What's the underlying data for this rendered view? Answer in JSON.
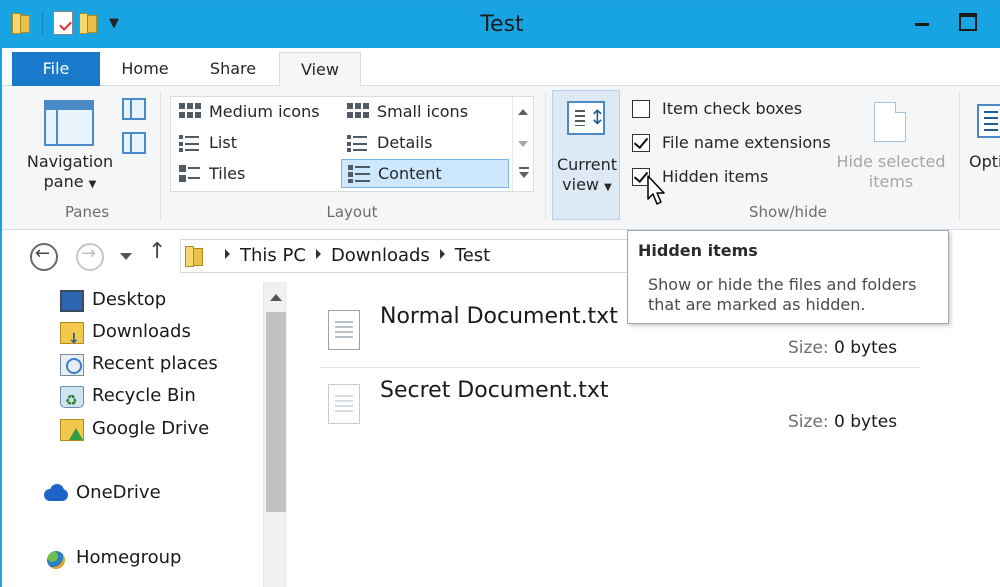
{
  "window": {
    "title": "Test"
  },
  "tabs": {
    "file": "File",
    "home": "Home",
    "share": "Share",
    "view": "View"
  },
  "ribbon": {
    "panes": {
      "navigation_pane_label": "Navigation pane",
      "group_label": "Panes"
    },
    "layout": {
      "group_label": "Layout",
      "items": [
        "Medium icons",
        "Small icons",
        "List",
        "Details",
        "Tiles",
        "Content"
      ],
      "selected": "Content"
    },
    "current_view": {
      "label": "Current view"
    },
    "show_hide": {
      "group_label": "Show/hide",
      "item_check_boxes": {
        "label": "Item check boxes",
        "checked": false
      },
      "file_name_extensions": {
        "label": "File name extensions",
        "checked": true
      },
      "hidden_items": {
        "label": "Hidden items",
        "checked": true
      },
      "hide_selected_items": "Hide selected items"
    },
    "options_label": "Opti"
  },
  "address": {
    "crumbs": [
      "This PC",
      "Downloads",
      "Test"
    ]
  },
  "nav_pane": {
    "items": [
      "Desktop",
      "Downloads",
      "Recent places",
      "Recycle Bin",
      "Google Drive"
    ],
    "onedrive": "OneDrive",
    "homegroup": "Homegroup"
  },
  "files": [
    {
      "name": "Normal Document.txt",
      "size_key": "Size:",
      "size_value": "0 bytes"
    },
    {
      "name": "Secret Document.txt",
      "size_key": "Size:",
      "size_value": "0 bytes"
    }
  ],
  "tooltip": {
    "title": "Hidden items",
    "body": "Show or hide the files and folders that are marked as hidden."
  }
}
